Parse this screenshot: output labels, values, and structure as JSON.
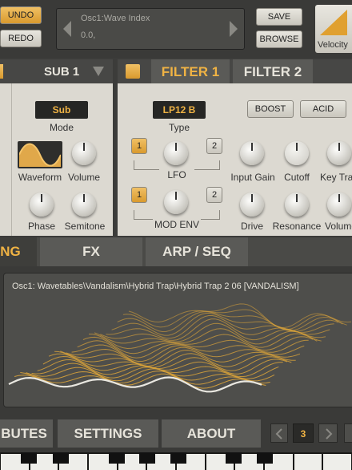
{
  "toolbar": {
    "undo_label": "UNDO",
    "redo_label": "REDO",
    "param_name": "Osc1:Wave Index",
    "param_value": "0.0,",
    "save_label": "SAVE",
    "browse_label": "BROWSE",
    "velocity_label": "Velocity"
  },
  "sub_panel": {
    "title": "SUB 1",
    "mode_value": "Sub",
    "mode_label": "Mode",
    "waveform_label": "Waveform",
    "volume_label": "Volume",
    "phase_label": "Phase",
    "semitone_label": "Semitone"
  },
  "filter_panel": {
    "tabs": [
      "FILTER 1",
      "FILTER 2"
    ],
    "type_value": "LP12 B",
    "type_label": "Type",
    "boost_label": "BOOST",
    "acid_label": "ACID",
    "lfo": {
      "label": "LFO",
      "btn1": "1",
      "btn2": "2"
    },
    "mod_env": {
      "label": "MOD ENV",
      "btn1": "1",
      "btn2": "2"
    },
    "knob_labels": [
      "Input Gain",
      "Cutoff",
      "Key Trac",
      "Drive",
      "Resonance",
      "Volume"
    ]
  },
  "section_tabs": [
    "NG",
    "FX",
    "ARP / SEQ"
  ],
  "wavetable": {
    "title": "Osc1: Wavetables\\Vandalism\\Hybrid Trap\\Hybrid Trap 2 06 [VANDALISM]"
  },
  "bottom_nav": {
    "tabs": [
      "BUTES",
      "SETTINGS",
      "ABOUT"
    ],
    "prev_icon": "chevron-left-icon",
    "page_value": "3",
    "next_icon": "chevron-right-icon"
  },
  "colors": {
    "accent": "#f0b344",
    "panel": "#dcd9d1",
    "dark": "#2c2c2a"
  }
}
